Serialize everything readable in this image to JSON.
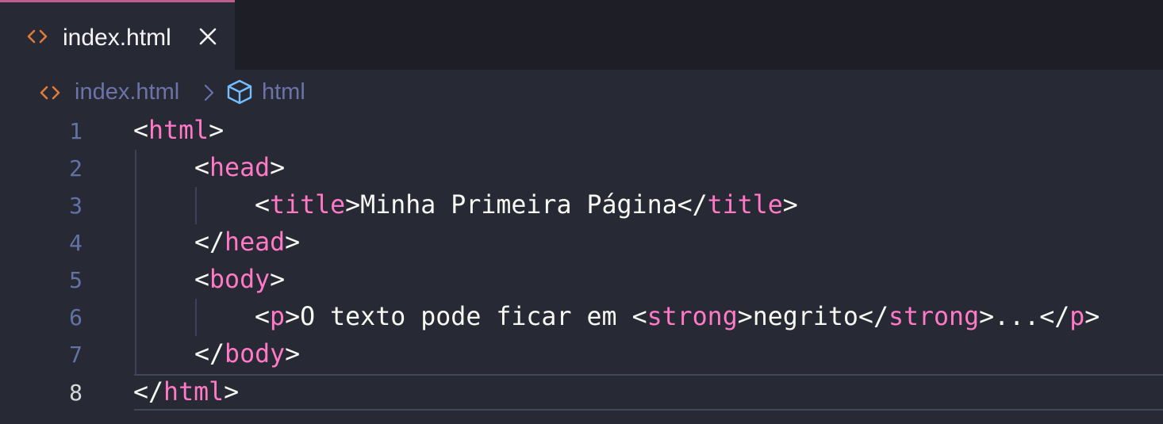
{
  "tab": {
    "file_icon": "code-brackets-icon",
    "label": "index.html",
    "close_icon": "close-icon"
  },
  "breadcrumb": {
    "file_icon": "code-brackets-icon",
    "file_label": "index.html",
    "separator_icon": "chevron-right-icon",
    "symbol_icon": "cube-icon",
    "symbol_label": "html"
  },
  "editor": {
    "active_line": 8,
    "lines": [
      {
        "number": "1",
        "tokens": [
          [
            "punc",
            "<"
          ],
          [
            "tag",
            "html"
          ],
          [
            "punc",
            ">"
          ]
        ]
      },
      {
        "number": "2",
        "tokens": [
          [
            "punc",
            "<"
          ],
          [
            "tag",
            "head"
          ],
          [
            "punc",
            ">"
          ]
        ]
      },
      {
        "number": "3",
        "tokens": [
          [
            "punc",
            "<"
          ],
          [
            "tag",
            "title"
          ],
          [
            "punc",
            ">"
          ],
          [
            "txt",
            "Minha Primeira Página"
          ],
          [
            "punc",
            "</"
          ],
          [
            "tag",
            "title"
          ],
          [
            "punc",
            ">"
          ]
        ]
      },
      {
        "number": "4",
        "tokens": [
          [
            "punc",
            "</"
          ],
          [
            "tag",
            "head"
          ],
          [
            "punc",
            ">"
          ]
        ]
      },
      {
        "number": "5",
        "tokens": [
          [
            "punc",
            "<"
          ],
          [
            "tag",
            "body"
          ],
          [
            "punc",
            ">"
          ]
        ]
      },
      {
        "number": "6",
        "tokens": [
          [
            "punc",
            "<"
          ],
          [
            "tag",
            "p"
          ],
          [
            "punc",
            ">"
          ],
          [
            "txt",
            "O texto pode ficar em "
          ],
          [
            "punc",
            "<"
          ],
          [
            "tag",
            "strong"
          ],
          [
            "punc",
            ">"
          ],
          [
            "txt",
            "negrito"
          ],
          [
            "punc",
            "</"
          ],
          [
            "tag",
            "strong"
          ],
          [
            "punc",
            ">"
          ],
          [
            "txt",
            "..."
          ],
          [
            "punc",
            "</"
          ],
          [
            "tag",
            "p"
          ],
          [
            "punc",
            ">"
          ]
        ]
      },
      {
        "number": "7",
        "tokens": [
          [
            "punc",
            "</"
          ],
          [
            "tag",
            "body"
          ],
          [
            "punc",
            ">"
          ]
        ]
      },
      {
        "number": "8",
        "tokens": [
          [
            "punc",
            "</"
          ],
          [
            "tag",
            "html"
          ],
          [
            "punc",
            ">"
          ]
        ]
      }
    ]
  },
  "colors": {
    "background": "#272935",
    "tab_bar": "#1d1e26",
    "tab_accent": "#bd5c8e",
    "tag": "#ff79c6",
    "text": "#f8f8f2",
    "line_number": "#6272a4",
    "breadcrumb_text": "#6c73a8",
    "file_icon": "#e07b39",
    "symbol_icon": "#75beff"
  }
}
